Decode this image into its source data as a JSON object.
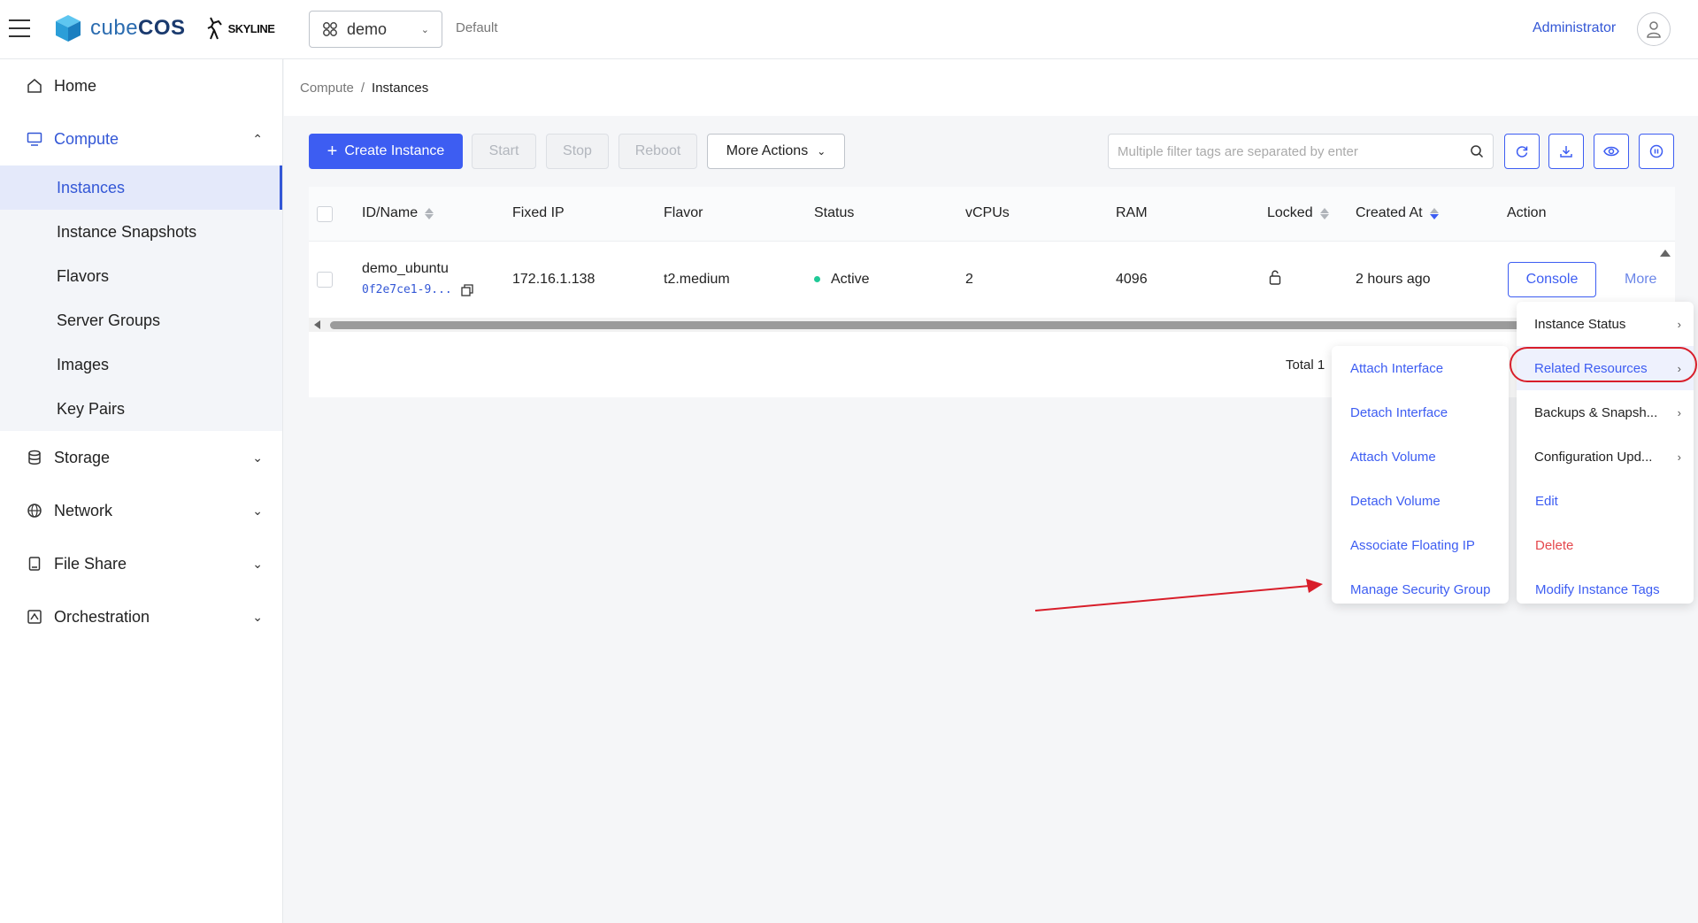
{
  "app": {
    "logo_text_light": "cube",
    "logo_text_bold": "COS",
    "skyline_label": "SKYLINE",
    "project": "demo",
    "domain": "Default",
    "user": "Administrator"
  },
  "sidebar": {
    "home": "Home",
    "compute": "Compute",
    "compute_items": [
      "Instances",
      "Instance Snapshots",
      "Flavors",
      "Server Groups",
      "Images",
      "Key Pairs"
    ],
    "storage": "Storage",
    "network": "Network",
    "file_share": "File Share",
    "orchestration": "Orchestration"
  },
  "breadcrumb": {
    "parent": "Compute",
    "sep": "/",
    "current": "Instances"
  },
  "toolbar": {
    "create": "Create Instance",
    "start": "Start",
    "stop": "Stop",
    "reboot": "Reboot",
    "more_actions": "More Actions",
    "search_placeholder": "Multiple filter tags are separated by enter"
  },
  "table": {
    "columns": [
      "ID/Name",
      "Fixed IP",
      "Flavor",
      "Status",
      "vCPUs",
      "RAM",
      "Locked",
      "Created At",
      "Action"
    ],
    "rows": [
      {
        "name": "demo_ubuntu",
        "id": "0f2e7ce1-9...",
        "fixed_ip": "172.16.1.138",
        "flavor": "t2.medium",
        "status": "Active",
        "vcpus": "2",
        "ram": "4096",
        "created_at": "2 hours ago",
        "console": "Console",
        "more": "More"
      }
    ],
    "total": "Total 1"
  },
  "more_menu": {
    "items": [
      "Instance Status",
      "Related Resources",
      "Backups & Snapsh...",
      "Configuration Upd...",
      "Edit",
      "Delete",
      "Modify Instance Tags"
    ]
  },
  "related_menu": {
    "items": [
      "Attach Interface",
      "Detach Interface",
      "Attach Volume",
      "Detach Volume",
      "Associate Floating IP",
      "Manage Security Group"
    ]
  },
  "colors": {
    "primary": "#3d5df2",
    "link": "#3357d6",
    "danger": "#e5484d",
    "active_status": "#20c997",
    "annotation": "#d81e2a"
  }
}
